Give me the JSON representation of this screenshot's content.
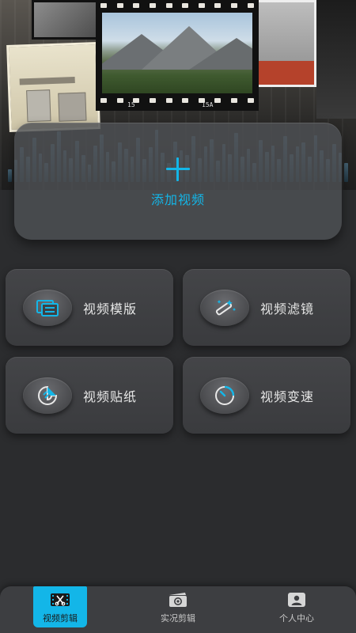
{
  "hero": {
    "add_label": "添加视频",
    "film_numbers": [
      "15",
      "15A"
    ]
  },
  "features": [
    {
      "label": "视频模版",
      "icon": "template-icon"
    },
    {
      "label": "视频滤镜",
      "icon": "magic-wand-icon"
    },
    {
      "label": "视频贴纸",
      "icon": "sticker-icon"
    },
    {
      "label": "视频变速",
      "icon": "speed-dial-icon"
    }
  ],
  "tabs": [
    {
      "label": "视频剪辑",
      "icon": "film-scissors-icon",
      "active": true
    },
    {
      "label": "实况剪辑",
      "icon": "live-clip-icon",
      "active": false
    },
    {
      "label": "个人中心",
      "icon": "profile-icon",
      "active": false
    }
  ],
  "colors": {
    "accent": "#13b6e8",
    "background": "#2b2c2e",
    "card": "#444548",
    "text": "#e6e6e6"
  }
}
